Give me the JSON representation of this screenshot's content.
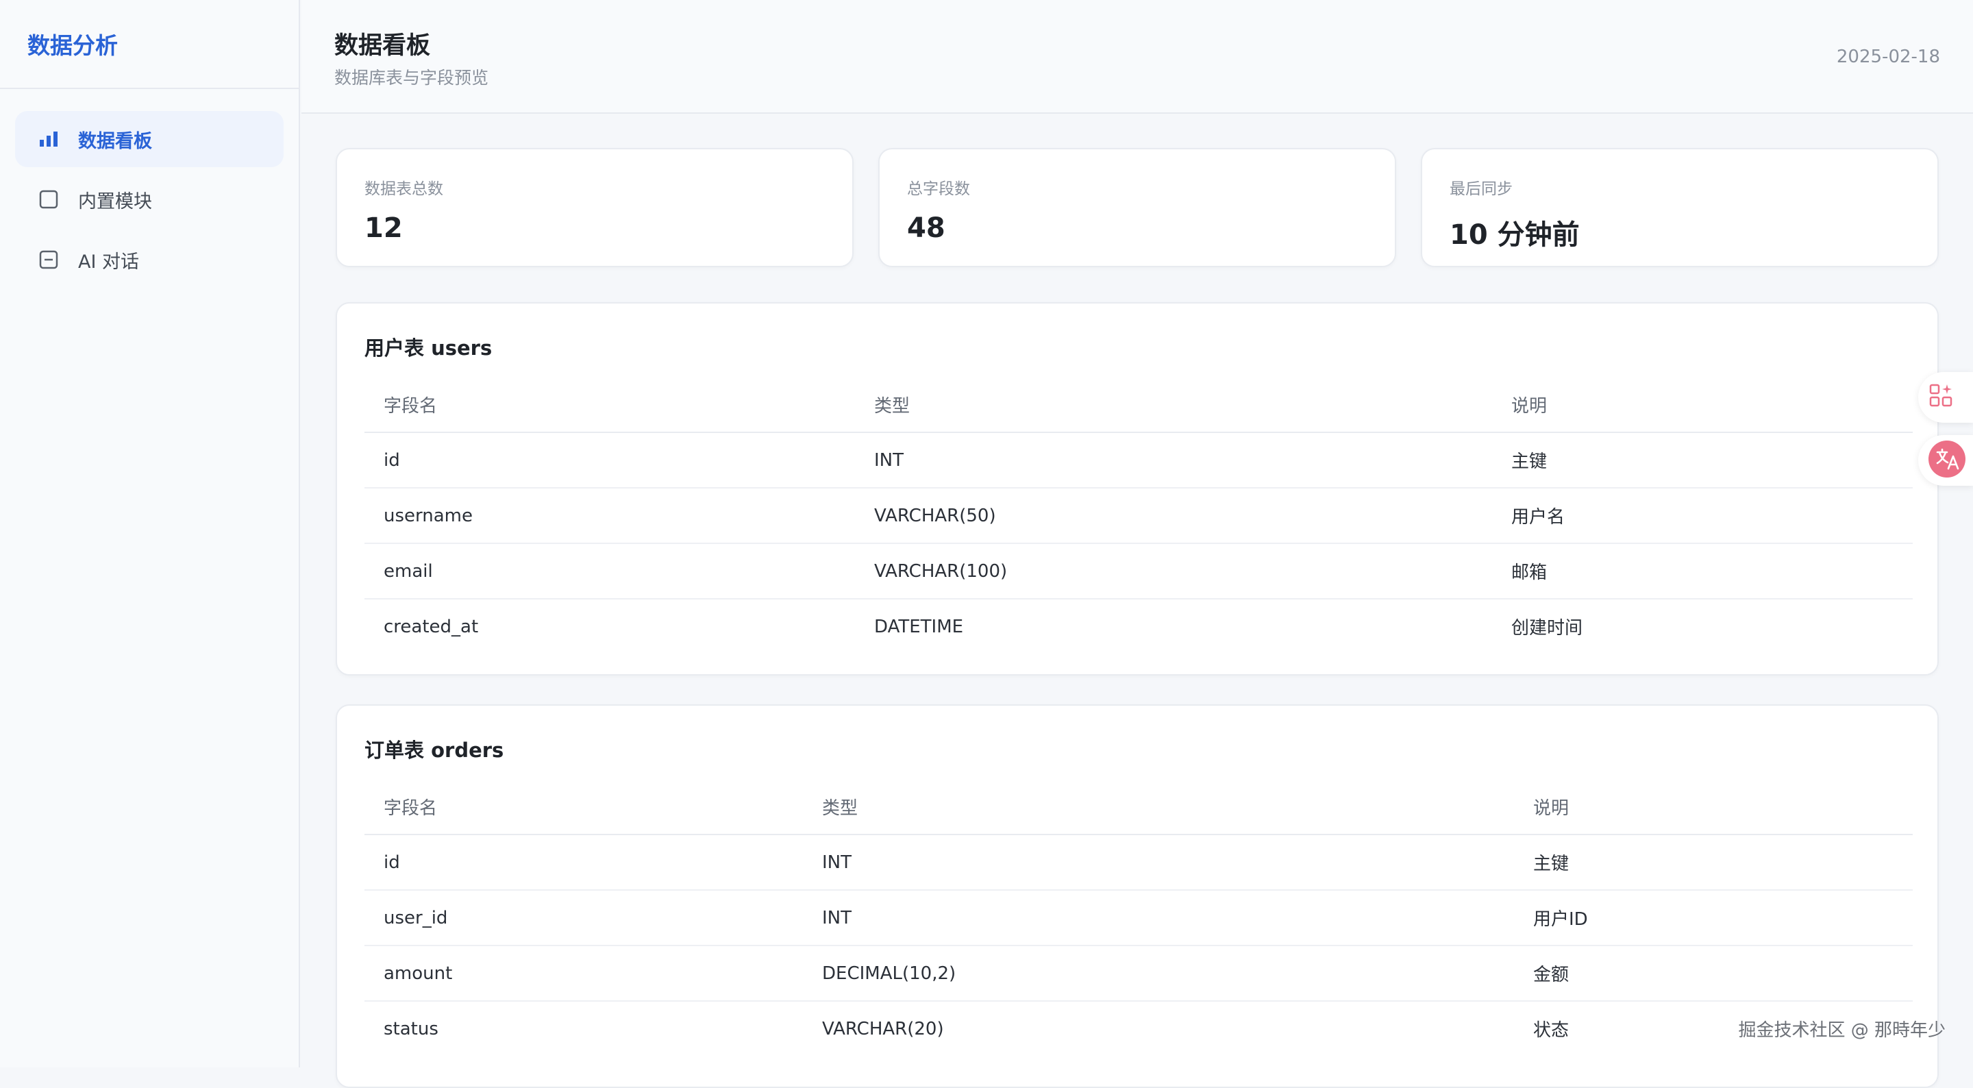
{
  "app": {
    "brand": "数据分析"
  },
  "sidebar": {
    "items": [
      {
        "label": "数据看板",
        "icon": "bar-chart-icon",
        "active": true
      },
      {
        "label": "内置模块",
        "icon": "square-icon",
        "active": false
      },
      {
        "label": "AI 对话",
        "icon": "minus-box-icon",
        "active": false
      }
    ]
  },
  "header": {
    "title": "数据看板",
    "subtitle": "数据库表与字段预览",
    "date": "2025-02-18"
  },
  "stats": [
    {
      "label": "数据表总数",
      "value": "12"
    },
    {
      "label": "总字段数",
      "value": "48"
    },
    {
      "label": "最后同步",
      "value": "10 分钟前"
    }
  ],
  "tables": [
    {
      "title": "用户表 users",
      "headers": [
        "字段名",
        "类型",
        "说明"
      ],
      "rows": [
        [
          "id",
          "INT",
          "主键"
        ],
        [
          "username",
          "VARCHAR(50)",
          "用户名"
        ],
        [
          "email",
          "VARCHAR(100)",
          "邮箱"
        ],
        [
          "created_at",
          "DATETIME",
          "创建时间"
        ]
      ]
    },
    {
      "title": "订单表 orders",
      "headers": [
        "字段名",
        "类型",
        "说明"
      ],
      "rows": [
        [
          "id",
          "INT",
          "主键"
        ],
        [
          "user_id",
          "INT",
          "用户ID"
        ],
        [
          "amount",
          "DECIMAL(10,2)",
          "金额"
        ],
        [
          "status",
          "VARCHAR(20)",
          "状态"
        ]
      ]
    }
  ],
  "floating": [
    {
      "icon": "apps-add-icon"
    },
    {
      "icon": "translate-icon"
    }
  ],
  "watermark": "掘金技术社区 @ 那時年少",
  "colors": {
    "accent": "#2a63d6",
    "active_bg": "#eef3fd",
    "translate_badge": "#ec6f86"
  }
}
